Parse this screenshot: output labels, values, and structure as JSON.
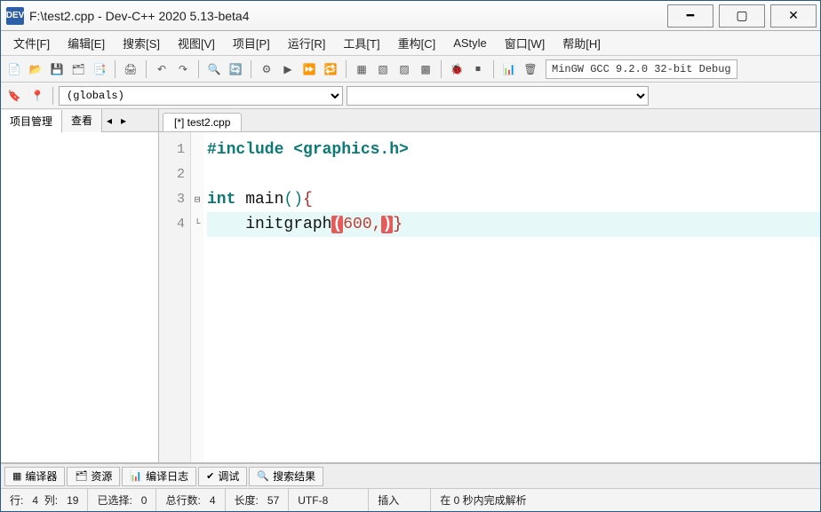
{
  "title": "F:\\test2.cpp - Dev-C++ 2020 5.13-beta4",
  "app_icon_label": "DEV",
  "menu": [
    "文件[F]",
    "编辑[E]",
    "搜索[S]",
    "视图[V]",
    "项目[P]",
    "运行[R]",
    "工具[T]",
    "重构[C]",
    "AStyle",
    "窗口[W]",
    "帮助[H]"
  ],
  "compiler_profile": "MinGW GCC 9.2.0 32-bit Debug",
  "globals_selected": "(globals)",
  "funcs_selected": "",
  "side_tabs": {
    "project": "项目管理",
    "view": "查看"
  },
  "file_tab": "[*] test2.cpp",
  "code": {
    "l1_pre": "#include <graphics.h>",
    "l3_kw": "int",
    "l3_id": " main",
    "l3_paren": "()",
    "l3_brace": "{",
    "l4_indent": "    ",
    "l4_call": "initgraph",
    "l4_open": "(",
    "l4_arg": "600,",
    "l4_close": ")",
    "l4_brace": "}"
  },
  "gutter": [
    "1",
    "2",
    "3",
    "4"
  ],
  "fold": [
    "",
    "",
    "⊟",
    "└"
  ],
  "bottom_tabs": {
    "compiler": "编译器",
    "resources": "资源",
    "log": "编译日志",
    "debug": "调试",
    "search": "搜索结果"
  },
  "status": {
    "line_label": "行:",
    "line": "4",
    "col_label": "列:",
    "col": "19",
    "sel_label": "已选择:",
    "sel": "0",
    "total_label": "总行数:",
    "total": "4",
    "len_label": "长度:",
    "len": "57",
    "encoding": "UTF-8",
    "mode": "插入",
    "parse": "在 0 秒内完成解析"
  }
}
